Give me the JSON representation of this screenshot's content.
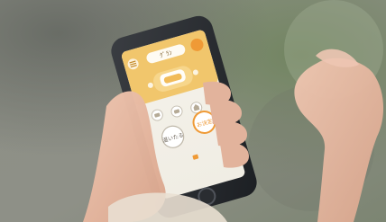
{
  "photo": {
    "subject": "hand-holding-smartphone",
    "colors": {
      "background_gray": "#8a8d84",
      "background_green": "#7f8f6a",
      "phone_body": "#2c2f33",
      "app_yellow": "#f1c66c",
      "app_white": "#f4f1e8",
      "skin": "#e3b9a3",
      "accent_orange": "#ef9a36"
    }
  },
  "app_screen": {
    "header_pill": "ｸﾞﾗﾝ",
    "buttons": {
      "left_circle": "温いたる",
      "right_circle": "お決定"
    },
    "mini_icons": [
      "icon-1",
      "icon-2",
      "icon-3"
    ]
  }
}
